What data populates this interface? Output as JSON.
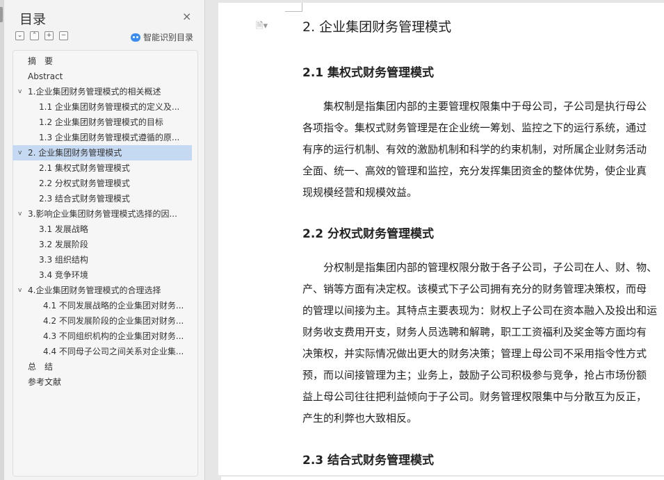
{
  "sidebar": {
    "title": "目录",
    "close_glyph": "×",
    "tools": [
      "⌄",
      "⌃",
      "+",
      "−"
    ],
    "smart_label": "智能识别目录",
    "items": [
      {
        "label": "摘　要",
        "level": "l0",
        "caret": "",
        "selected": false
      },
      {
        "label": "Abstract",
        "level": "l0",
        "caret": "",
        "selected": false
      },
      {
        "label": "1.企业集团财务管理模式的相关概述",
        "level": "l1",
        "caret": "v",
        "selected": false
      },
      {
        "label": "1.1 企业集团财务管理模式的定义及...",
        "level": "l2",
        "caret": "",
        "selected": false
      },
      {
        "label": "1.2 企业集团财务管理模式的目标",
        "level": "l2",
        "caret": "",
        "selected": false
      },
      {
        "label": "1.3 企业集团财务管理模式遵循的原...",
        "level": "l2",
        "caret": "",
        "selected": false
      },
      {
        "label": "2. 企业集团财务管理模式",
        "level": "l1",
        "caret": "v",
        "selected": true
      },
      {
        "label": "2.1  集权式财务管理模式",
        "level": "l2",
        "caret": "",
        "selected": false
      },
      {
        "label": "2.2 分权式财务管理模式",
        "level": "l2",
        "caret": "",
        "selected": false
      },
      {
        "label": "2.3 结合式财务管理模式",
        "level": "l2",
        "caret": "",
        "selected": false
      },
      {
        "label": "3.影响企业集团财务管理模式选择的因...",
        "level": "l1",
        "caret": "v",
        "selected": false
      },
      {
        "label": "3.1 发展战略",
        "level": "l2",
        "caret": "",
        "selected": false
      },
      {
        "label": "3.2 发展阶段",
        "level": "l2",
        "caret": "",
        "selected": false
      },
      {
        "label": "3.3 组织结构",
        "level": "l2",
        "caret": "",
        "selected": false
      },
      {
        "label": "3.4  竞争环境",
        "level": "l2",
        "caret": "",
        "selected": false
      },
      {
        "label": "4.企业集团财务管理模式的合理选择",
        "level": "l1",
        "caret": "v",
        "selected": false
      },
      {
        "label": "4.1 不同发展战略的企业集团对财务...",
        "level": "l2b",
        "caret": "",
        "selected": false
      },
      {
        "label": "4.2 不同发展阶段的企业集团对财务...",
        "level": "l2b",
        "caret": "",
        "selected": false
      },
      {
        "label": "4.3 不同组织机构的企业集团对财务...",
        "level": "l2b",
        "caret": "",
        "selected": false
      },
      {
        "label": "4.4 不同母子公司之间关系对企业集...",
        "level": "l2b",
        "caret": "",
        "selected": false
      },
      {
        "label": "总　结",
        "level": "l0",
        "caret": "",
        "selected": false
      },
      {
        "label": "参考文献",
        "level": "l0",
        "caret": "",
        "selected": false
      }
    ]
  },
  "document": {
    "heading_main": "2.  企业集团财务管理模式",
    "section_21_title": "2.1  集权式财务管理模式",
    "section_21_lines": [
      "集权制是指集团内部的主要管理权限集中于母公司，子公司是执行母公",
      "各项指令。集权式财务管理是在企业统一筹划、监控之下的运行系统，通过",
      "有序的运行机制、有效的激励机制和科学的约束机制，对所属企业财务活动",
      "全面、统一、高效的管理和监控，充分发挥集团资金的整体优势，使企业真",
      "现规模经营和规模效益。"
    ],
    "section_22_title": "2.2 分权式财务管理模式",
    "section_22_lines": [
      "分权制是指集团内部的管理权限分散于各子公司，子公司在人、财、物、",
      "产、销等方面有决定权。该模式下子公司拥有充分的财务管理决策权，而母",
      "的管理以间接为主。其特点主要表现为：财权上子公司在资本融入及投出和运",
      "财务收支费用开支，财务人员选聘和解聘，职工工资福利及奖金等方面均有",
      "决策权，并实际情况做出更大的财务决策；管理上母公司不采用指令性方式",
      "预，而以间接管理为主；业务上，鼓励子公司积极参与竞争，抢占市场份额",
      "益上母公司往往把利益倾向于子公司。财务管理权限集中与分散互为反正，",
      "产生的利弊也大致相反。"
    ],
    "section_23_title": "2.3 结合式财务管理模式",
    "doc_icon": "🗎▾"
  }
}
